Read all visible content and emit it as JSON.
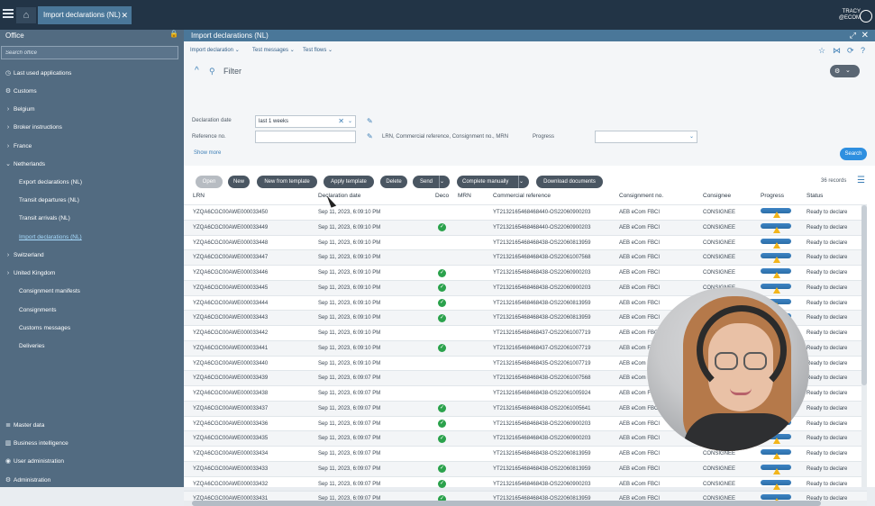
{
  "topbar": {
    "tab_label": "Import declarations (NL)",
    "user_line1": "TRACY",
    "user_line2": "@ECOM"
  },
  "sidebar": {
    "title": "Office",
    "search_placeholder": "Search office",
    "items": [
      {
        "label": "Last used applications",
        "icon": "clock-icon"
      },
      {
        "label": "Customs",
        "icon": "gear-icon"
      },
      {
        "label": "Belgium",
        "icon": "chevron-right-icon"
      },
      {
        "label": "Broker instructions",
        "icon": "chevron-right-icon"
      },
      {
        "label": "France",
        "icon": "chevron-right-icon"
      },
      {
        "label": "Netherlands",
        "icon": "chevron-down-icon"
      },
      {
        "label": "Export declarations (NL)"
      },
      {
        "label": "Transit departures (NL)"
      },
      {
        "label": "Transit arrivals (NL)"
      },
      {
        "label": "Import declarations (NL)",
        "active": true
      },
      {
        "label": "Switzerland",
        "icon": "chevron-right-icon"
      },
      {
        "label": "United Kingdom",
        "icon": "chevron-right-icon"
      },
      {
        "label": "Consignment manifests"
      },
      {
        "label": "Consignments"
      },
      {
        "label": "Customs messages"
      },
      {
        "label": "Deliveries"
      }
    ],
    "bottom_items": [
      {
        "label": "Master data",
        "icon": "database-icon"
      },
      {
        "label": "Business intelligence",
        "icon": "chart-icon"
      },
      {
        "label": "User administration",
        "icon": "user-icon"
      },
      {
        "label": "Administration",
        "icon": "gear-icon"
      }
    ]
  },
  "main": {
    "title": "Import declarations (NL)",
    "menus": [
      "Import declaration",
      "Test messages",
      "Test flows"
    ],
    "filter": {
      "title": "Filter",
      "declaration_date_label": "Declaration date",
      "declaration_date_value": "last 1 weeks",
      "reference_label": "Reference no.",
      "reference_value": "",
      "reference_desc": "LRN, Commercial reference, Consignment no., MRN",
      "progress_label": "Progress",
      "progress_value": "",
      "show_more": "Show more",
      "search_button": "Search"
    },
    "actions": {
      "open": "Open",
      "new": "New",
      "new_from_template": "New from template",
      "apply_template": "Apply template",
      "delete": "Delete",
      "send": "Send",
      "complete_manually": "Complete manually",
      "download_documents": "Download documents"
    },
    "records": "36 records",
    "columns": [
      "LRN",
      "Declaration date",
      "Deco",
      "MRN",
      "Commercial reference",
      "Consignment no.",
      "Consignee",
      "Progress",
      "Status"
    ],
    "rows": [
      {
        "lrn": "YZQA6CGC00AWE000033450",
        "date": "Sep 11, 2023, 6:09:10 PM",
        "deco": false,
        "ref": "YT213216546846844​0-OS22060900203",
        "cons": "AEB eCom FBCI",
        "consignee": "CONSIGNEE",
        "status": "Ready to declare"
      },
      {
        "lrn": "YZQA6CGC00AWE000033449",
        "date": "Sep 11, 2023, 6:09:10 PM",
        "deco": true,
        "ref": "YT2132165468468440-OS22060900203",
        "cons": "AEB eCom FBCI",
        "consignee": "CONSIGNEE",
        "status": "Ready to declare"
      },
      {
        "lrn": "YZQA6CGC00AWE000033448",
        "date": "Sep 11, 2023, 6:09:10 PM",
        "deco": false,
        "ref": "YT2132165468468438-OS22060813959",
        "cons": "AEB eCom FBCI",
        "consignee": "CONSIGNEE",
        "status": "Ready to declare"
      },
      {
        "lrn": "YZQA6CGC00AWE000033447",
        "date": "Sep 11, 2023, 6:09:10 PM",
        "deco": false,
        "ref": "YT2132165468468438-OS22061007568",
        "cons": "AEB eCom FBCI",
        "consignee": "CONSIGNEE",
        "status": "Ready to declare"
      },
      {
        "lrn": "YZQA6CGC00AWE000033446",
        "date": "Sep 11, 2023, 6:09:10 PM",
        "deco": true,
        "ref": "YT2132165468468438-OS22060900203",
        "cons": "AEB eCom FBCI",
        "consignee": "CONSIGNEE",
        "status": "Ready to declare"
      },
      {
        "lrn": "YZQA6CGC00AWE000033445",
        "date": "Sep 11, 2023, 6:09:10 PM",
        "deco": true,
        "ref": "YT2132165468468438-OS22060900203",
        "cons": "AEB eCom FBCI",
        "consignee": "CONSIGNEE",
        "status": "Ready to declare"
      },
      {
        "lrn": "YZQA6CGC00AWE000033444",
        "date": "Sep 11, 2023, 6:09:10 PM",
        "deco": true,
        "ref": "YT2132165468468438-OS22060813959",
        "cons": "AEB eCom FBCI",
        "consignee": "CONSIGNEE",
        "status": "Ready to declare"
      },
      {
        "lrn": "YZQA6CGC00AWE000033443",
        "date": "Sep 11, 2023, 6:09:10 PM",
        "deco": true,
        "ref": "YT2132165468468438-OS22060813959",
        "cons": "AEB eCom FBCI",
        "consignee": "CONSIGNEE",
        "status": "Ready to declare"
      },
      {
        "lrn": "YZQA6CGC00AWE000033442",
        "date": "Sep 11, 2023, 6:09:10 PM",
        "deco": false,
        "ref": "YT2132165468468437-OS22061007719",
        "cons": "AEB eCom FBCI",
        "consignee": "CONSIGNEE",
        "status": "Ready to declare"
      },
      {
        "lrn": "YZQA6CGC00AWE000033441",
        "date": "Sep 11, 2023, 6:09:10 PM",
        "deco": true,
        "ref": "YT2132165468468437-OS22061007719",
        "cons": "AEB eCom FBCI",
        "consignee": "CONSIGNEE",
        "status": "Ready to declare"
      },
      {
        "lrn": "YZQA6CGC00AWE000033440",
        "date": "Sep 11, 2023, 6:09:10 PM",
        "deco": false,
        "ref": "YT2132165468468435-OS22061007719",
        "cons": "AEB eCom FBCI",
        "consignee": "CONSIGNEE",
        "status": "Ready to declare"
      },
      {
        "lrn": "YZQA6CGC00AWE000033439",
        "date": "Sep 11, 2023, 6:09:07 PM",
        "deco": false,
        "ref": "YT2132165468468438-OS22061007568",
        "cons": "AEB eCom F",
        "consignee": "CONSIGNEE",
        "status": "Ready to declare"
      },
      {
        "lrn": "YZQA6CGC00AWE000033438",
        "date": "Sep 11, 2023, 6:09:07 PM",
        "deco": false,
        "ref": "YT2132165468468438-OS22061005924",
        "cons": "AEB eCom FBCI",
        "consignee": "CONSIGNEE",
        "status": "Ready to declare"
      },
      {
        "lrn": "YZQA6CGC00AWE000033437",
        "date": "Sep 11, 2023, 6:09:07 PM",
        "deco": true,
        "ref": "YT2132165468468438-OS22061005641",
        "cons": "AEB eCom FBCI",
        "consignee": "CONSIGNEE",
        "status": "Ready to declare"
      },
      {
        "lrn": "YZQA6CGC00AWE000033436",
        "date": "Sep 11, 2023, 6:09:07 PM",
        "deco": true,
        "ref": "YT2132165468468438-OS22060900203",
        "cons": "AEB eCom FBCI",
        "consignee": "CONSIGNEE",
        "status": "Ready to declare"
      },
      {
        "lrn": "YZQA6CGC00AWE000033435",
        "date": "Sep 11, 2023, 6:09:07 PM",
        "deco": true,
        "ref": "YT2132165468468438-OS22060900203",
        "cons": "AEB eCom FBCI",
        "consignee": "CONSIGNEE",
        "status": "Ready to declare"
      },
      {
        "lrn": "YZQA6CGC00AWE000033434",
        "date": "Sep 11, 2023, 6:09:07 PM",
        "deco": false,
        "ref": "YT2132165468468438-OS22060813959",
        "cons": "AEB eCom FBCI",
        "consignee": "CONSIGNEE",
        "status": "Ready to declare"
      },
      {
        "lrn": "YZQA6CGC00AWE000033433",
        "date": "Sep 11, 2023, 6:09:07 PM",
        "deco": true,
        "ref": "YT2132165468468438-OS22060813959",
        "cons": "AEB eCom FBCI",
        "consignee": "CONSIGNEE",
        "status": "Ready to declare"
      },
      {
        "lrn": "YZQA6CGC00AWE000033432",
        "date": "Sep 11, 2023, 6:09:07 PM",
        "deco": true,
        "ref": "YT2132165468468438-OS22060900203",
        "cons": "AEB eCom FBCI",
        "consignee": "CONSIGNEE",
        "status": "Ready to declare"
      },
      {
        "lrn": "YZQA6CGC00AWE000033431",
        "date": "Sep 11, 2023, 6:09:07 PM",
        "deco": true,
        "ref": "YT2132165468468438-OS22060813959",
        "cons": "AEB eCom FBCI",
        "consignee": "CONSIGNEE",
        "status": "Ready to declare"
      }
    ]
  }
}
